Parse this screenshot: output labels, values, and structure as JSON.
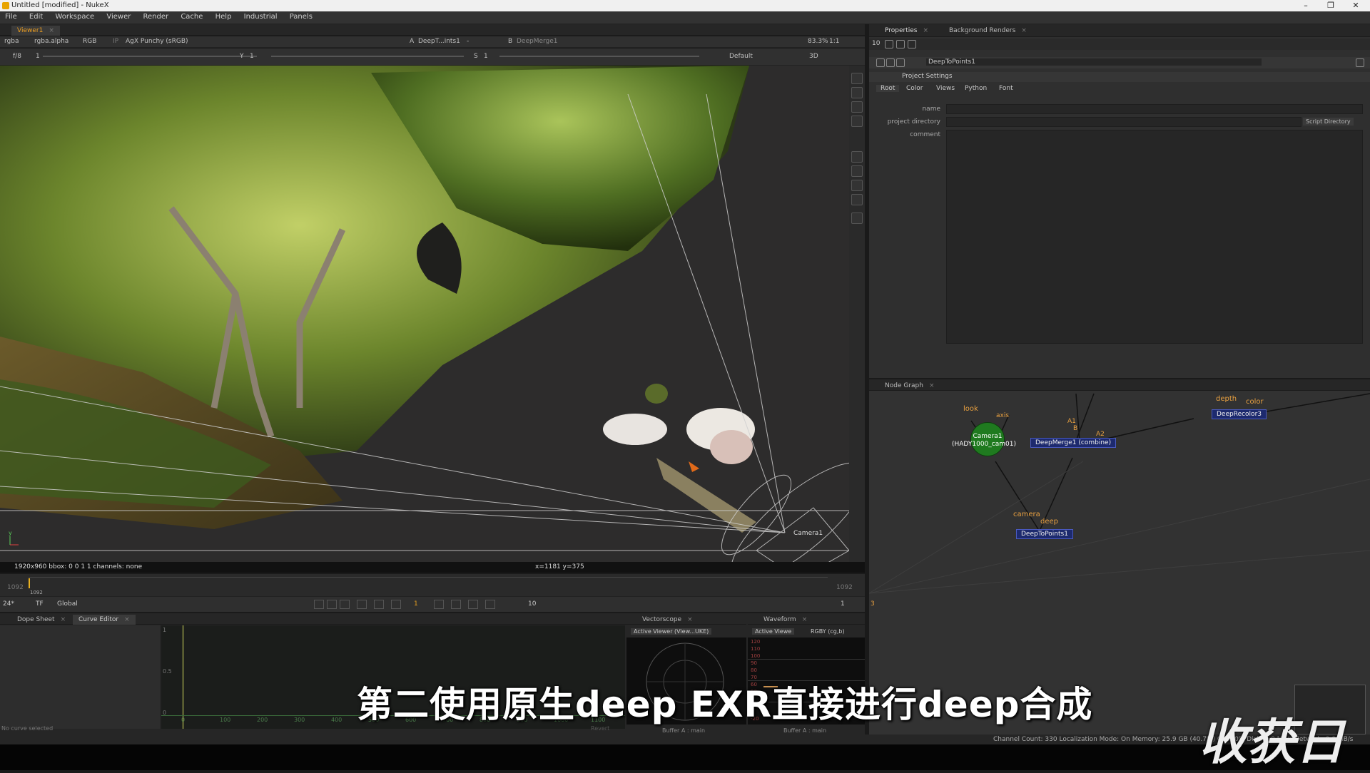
{
  "window": {
    "title": "Untitled [modified] - NukeX",
    "minimize": "–",
    "maximize": "❐",
    "close": "✕"
  },
  "menu": [
    "File",
    "Edit",
    "Workspace",
    "Viewer",
    "Render",
    "Cache",
    "Help",
    "Industrial",
    "Panels"
  ],
  "viewer": {
    "tab": "Viewer1",
    "channels": "rgba",
    "alpha": "rgba.alpha",
    "colorspace_mode": "RGB",
    "ip": "IP",
    "view_transform": "AgX Punchy (sRGB)",
    "input_a_label": "A",
    "input_a": "DeepT...ints1",
    "dash": "-",
    "input_b_label": "B",
    "input_b": "DeepMerge1",
    "zoom": "83.3%",
    "ratio": "1:1",
    "fstop": "f/8",
    "frame_sep": "1",
    "y_label": "Y",
    "y_val": "1",
    "s_label": "S",
    "s_val": "1",
    "lut": "Default",
    "mode3d": "3D",
    "camera_label": "Camera1",
    "status_left": "1920x960  bbox: 0 0 1 1 channels: none",
    "status_coord": "x=1181 y=375",
    "axis_y": "y"
  },
  "timeline": {
    "start": "1092",
    "end": "1092",
    "marker": "1092",
    "fps": "24*",
    "tf": "TF",
    "global": "Global",
    "frame": "1",
    "step": "10",
    "end_frame": "1",
    "s": "1"
  },
  "curve": {
    "dope_tab": "Dope Sheet",
    "curve_tab": "Curve Editor",
    "ticks": [
      "0",
      "100",
      "200",
      "300",
      "400",
      "500",
      "600",
      "700",
      "800",
      "900",
      "1000",
      "1100"
    ],
    "y_ticks": [
      "1",
      "0.5",
      "0"
    ],
    "no_curve": "No curve selected",
    "revert": "Revert"
  },
  "scopes": {
    "vectorscope_tab": "Vectorscope",
    "vs_source": "Active Viewer (View...UKE)",
    "vs_buffer": "Buffer A : main",
    "waveform_tab": "Waveform",
    "wf_source": "Active Viewe",
    "wf_mode": "RGBY (cg,b)",
    "wf_buffer": "Buffer A : main",
    "wf_ticks": [
      "120",
      "110",
      "100",
      "90",
      "80",
      "70",
      "60",
      "50",
      "-20"
    ]
  },
  "properties": {
    "tab": "Properties",
    "bg_tab": "Background Renders",
    "max_panels": "10",
    "node_name": "DeepToPoints1",
    "section": "Project Settings",
    "subtabs": [
      "Root",
      "Color",
      "Views",
      "Python",
      "Font"
    ],
    "name_label": "name",
    "dir_label": "project directory",
    "comment_label": "comment",
    "script_dir": "Script Directory"
  },
  "nodegraph": {
    "tab": "Node Graph",
    "camera": "Camera1\n(HADY1000_cam01)",
    "camera_line1": "Camera1",
    "camera_line2": "(HADY1000_cam01)",
    "merge": "DeepMerge1 (combine)",
    "recolor": "DeepRecolor3",
    "topoints": "DeepToPoints1",
    "labels": {
      "look": "look",
      "axis": "axis",
      "a1": "A1",
      "b": "B",
      "a2": "A2",
      "depth": "depth",
      "color": "color",
      "camera": "camera",
      "deep": "deep"
    },
    "corner": "3"
  },
  "status": "Channel Count: 330  Localization Mode: On  Memory: 25.9 GB (40.7%)  CPU: 0%  Disk: 0.0 MB/s  Network: 0.0 MB/s",
  "subtitle": "第二使用原生deep EXR直接进行deep合成",
  "watermark": "收获日"
}
